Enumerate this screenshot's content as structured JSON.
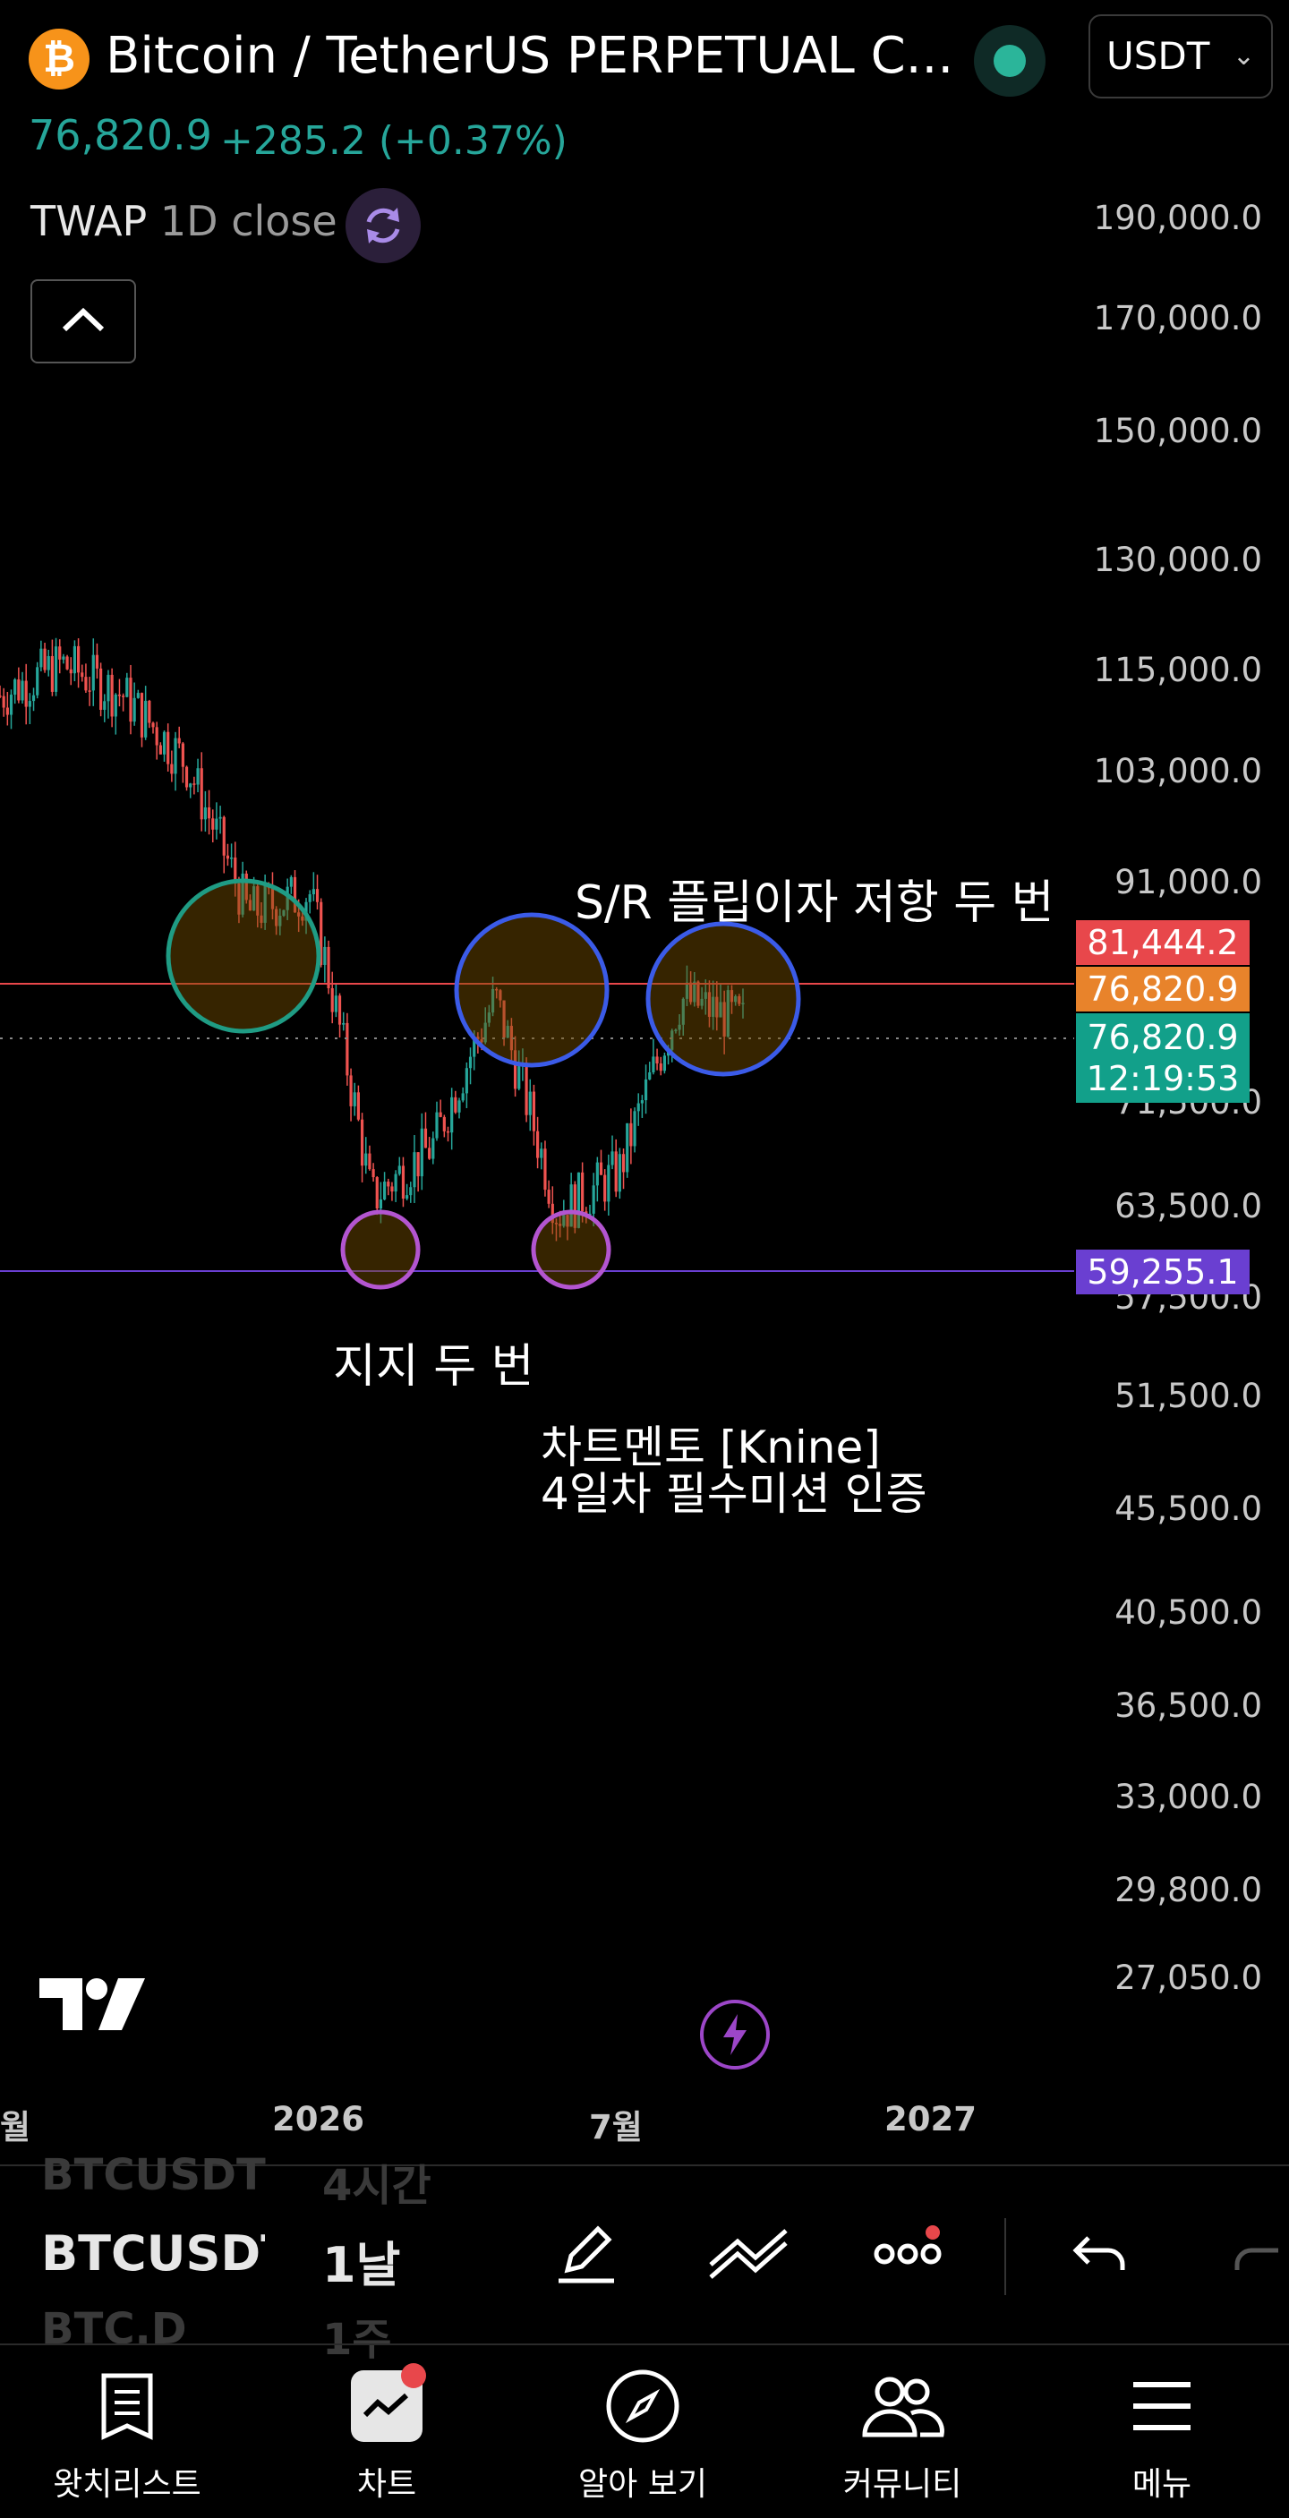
{
  "header": {
    "title": "Bitcoin / TetherUS PERPETUAL C...",
    "coin_symbol": "₿",
    "currency": "USDT",
    "price": "76,820.9",
    "change": "+285.2 (+0.37%)",
    "indicator_name": "TWAP",
    "indicator_params": "1D close"
  },
  "y_axis": {
    "ticks": [
      "190,000.0",
      "170,000.0",
      "150,000.0",
      "130,000.0",
      "115,000.0",
      "103,000.0",
      "91,000.0",
      "71,500.0",
      "63,500.0",
      "57,500.0",
      "51,500.0",
      "45,500.0",
      "40,500.0",
      "36,500.0",
      "33,000.0",
      "29,800.0",
      "27,050.0"
    ]
  },
  "price_labels": {
    "resistance": "81,444.2",
    "twap": "76,820.9",
    "last": "76,820.9",
    "countdown": "12:19:53",
    "support": "59,255.1"
  },
  "annotations": {
    "sr_flip": "S/R 플립이자 저항 두 번",
    "support_twice": "지지 두 번",
    "mentor_line1": "차트멘토 [Knine]",
    "mentor_line2": "4일차 필수미션 인증"
  },
  "x_axis": {
    "ticks": [
      "월",
      "2026",
      "7월",
      "2027"
    ]
  },
  "toolbar": {
    "symbols": [
      "BTCUSDT",
      "BTCUSDT",
      "BTC.D"
    ],
    "intervals": [
      "4시간",
      "1날",
      "1주"
    ]
  },
  "bottom_nav": {
    "items": [
      "왓치리스트",
      "차트",
      "알아 보기",
      "커뮤니티",
      "메뉴"
    ]
  },
  "colors": {
    "up": "#26a69a",
    "down": "#ef5350",
    "resistance_line": "#e8474b",
    "twap_label": "#e8832b",
    "support_line": "#6a3fd1",
    "circle_green": "#1f9c84",
    "circle_blue": "#3b5be8",
    "circle_purple": "#b355d0"
  },
  "chart_data": {
    "type": "line",
    "x": [
      "2025-09",
      "2025-10",
      "2025-11",
      "2025-12",
      "2026-01",
      "2026-02",
      "2026-03",
      "2026-04",
      "2026-05",
      "2026-06",
      "2026-07",
      "2026-08",
      "2026-09"
    ],
    "series": [
      {
        "values": [
          112000,
          116000,
          112000,
          104000,
          88000,
          90000,
          64000,
          68000,
          80000,
          63000,
          66000,
          80000,
          78000
        ]
      }
    ],
    "y_scale": "log",
    "ylim": [
      26000,
      200000
    ],
    "horizontal_lines": [
      81444.2,
      76820.9,
      59255.1
    ]
  }
}
